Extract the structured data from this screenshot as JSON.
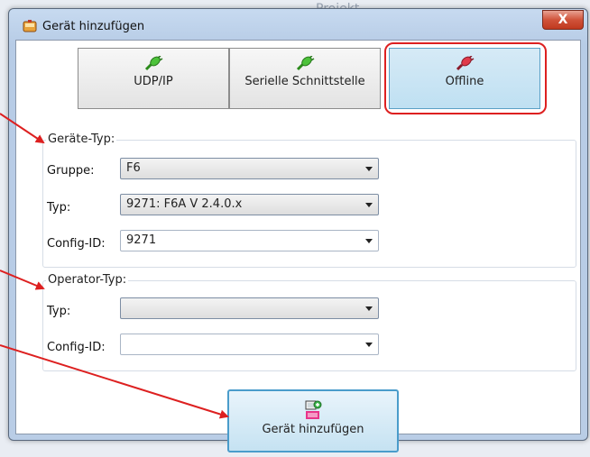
{
  "background": {
    "text": "Projekt"
  },
  "window": {
    "title": "Gerät hinzufügen",
    "close_symbol": "X"
  },
  "tabs": [
    {
      "label": "UDP/IP",
      "icon": "plug-green-icon",
      "active": false
    },
    {
      "label": "Serielle Schnittstelle",
      "icon": "plug-green-icon",
      "active": false
    },
    {
      "label": "Offline",
      "icon": "plug-red-icon",
      "active": true
    }
  ],
  "device_type": {
    "legend": "Geräte-Typ:",
    "group_label": "Gruppe:",
    "group_value": "F6",
    "type_label": "Typ:",
    "type_value": "9271: F6A V 2.4.0.x",
    "config_label": "Config-ID:",
    "config_value": "9271"
  },
  "operator_type": {
    "legend": "Operator-Typ:",
    "type_label": "Typ:",
    "type_value": "",
    "config_label": "Config-ID:",
    "config_value": ""
  },
  "add_button": {
    "label": "Gerät hinzufügen",
    "icon": "add-device-icon"
  },
  "colors": {
    "annotation_red": "#dd2020",
    "active_tab": "#bfe0f2",
    "button_border": "#4a9ccb"
  }
}
